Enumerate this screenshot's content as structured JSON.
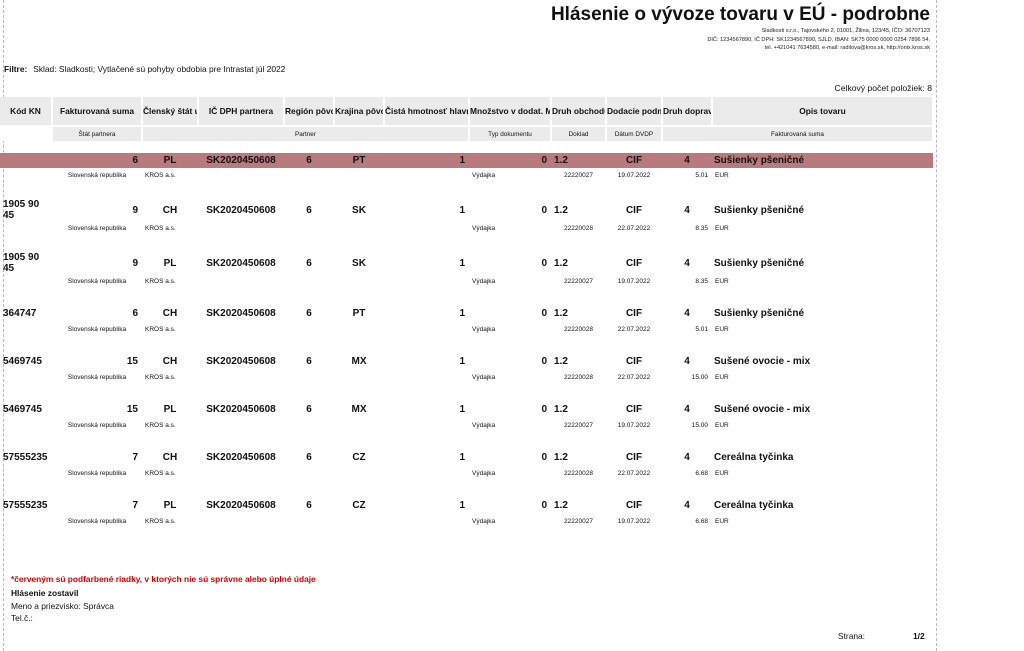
{
  "report": {
    "title": "Hlásenie o vývoze tovaru v EÚ - podrobne",
    "company_lines": [
      "Sladkosti s.r.o., Tajovského 2, 01001, Žilina, 123/45, IČO: 36707123",
      "DIČ: 1234567890, IČ DPH: SK1234567890, SJLD, IBAN: SK75 0000 0000 0254 7896 54,",
      "tel. +421041 7634580, e-mail: radilova@kros.sk, http://onix.kros.sk"
    ],
    "filter_label": "Filtre:",
    "filter_text": "Sklad: Sladkosti; Vytlačené sú pohyby obdobia pre Intrastat júl 2022",
    "total_label": "Celkový počet položiek: 8"
  },
  "headers": {
    "kod_kn": "Kód KN",
    "fakturovana_suma": "Fakturovaná suma",
    "clensky_stat": "Členský štát určenia",
    "ic_dph": "IČ DPH partnera",
    "region": "Región pôvodu",
    "krajina": "Krajina pôvodu",
    "hmotnost": "Čistá hmotnosť hlavnej MJ (kg)",
    "mnozstvo": "Množstvo v dodat. MJ",
    "druh_obchodu": "Druh obchodu",
    "dodacie": "Dodacie podmienky",
    "druh_dopravy": "Druh dopravy",
    "opis": "Opis tovaru"
  },
  "subheaders": {
    "stat_partnera": "Štát partnera",
    "partner": "Partner",
    "typ_dokumentu": "Typ dokumentu",
    "doklad": "Doklad",
    "datum": "Dátum DVDP",
    "fakturovana_suma": "Fakturovaná suma"
  },
  "rows": [
    {
      "kod": "",
      "suma": "6",
      "stat": "PL",
      "icdph": "SK2020450608",
      "region": "6",
      "krajina": "PT",
      "hmot": "1",
      "mnoz": "0",
      "obchod": "1.2",
      "dodacie": "CIF",
      "doprava": "4",
      "opis": "Sušienky pšeničné",
      "error": true,
      "sub": {
        "stat_partnera": "Slovenská republika",
        "partner": "KROS a.s.",
        "typ": "Výdajka",
        "doklad": "22220027",
        "datum": "19.07.2022",
        "suma": "5.01",
        "mena": "EUR"
      }
    },
    {
      "kod": "1905 90 45",
      "suma": "9",
      "stat": "CH",
      "icdph": "SK2020450608",
      "region": "6",
      "krajina": "SK",
      "hmot": "1",
      "mnoz": "0",
      "obchod": "1.2",
      "dodacie": "CIF",
      "doprava": "4",
      "opis": "Sušienky pšeničné",
      "error": false,
      "sub": {
        "stat_partnera": "Slovenská republika",
        "partner": "KROS a.s.",
        "typ": "Výdajka",
        "doklad": "22220028",
        "datum": "22.07.2022",
        "suma": "8.35",
        "mena": "EUR"
      }
    },
    {
      "kod": "1905 90 45",
      "suma": "9",
      "stat": "PL",
      "icdph": "SK2020450608",
      "region": "6",
      "krajina": "SK",
      "hmot": "1",
      "mnoz": "0",
      "obchod": "1.2",
      "dodacie": "CIF",
      "doprava": "4",
      "opis": "Sušienky pšeničné",
      "error": false,
      "sub": {
        "stat_partnera": "Slovenská republika",
        "partner": "KROS a.s.",
        "typ": "Výdajka",
        "doklad": "22220027",
        "datum": "19.07.2022",
        "suma": "8.35",
        "mena": "EUR"
      }
    },
    {
      "kod": "364747",
      "suma": "6",
      "stat": "CH",
      "icdph": "SK2020450608",
      "region": "6",
      "krajina": "PT",
      "hmot": "1",
      "mnoz": "0",
      "obchod": "1.2",
      "dodacie": "CIF",
      "doprava": "4",
      "opis": "Sušienky pšeničné",
      "error": false,
      "sub": {
        "stat_partnera": "Slovenská republika",
        "partner": "KROS a.s.",
        "typ": "Výdajka",
        "doklad": "22220028",
        "datum": "22.07.2022",
        "suma": "5.01",
        "mena": "EUR"
      }
    },
    {
      "kod": "5469745",
      "suma": "15",
      "stat": "CH",
      "icdph": "SK2020450608",
      "region": "6",
      "krajina": "MX",
      "hmot": "1",
      "mnoz": "0",
      "obchod": "1.2",
      "dodacie": "CIF",
      "doprava": "4",
      "opis": "Sušené ovocie - mix",
      "error": false,
      "sub": {
        "stat_partnera": "Slovenská republika",
        "partner": "KROS a.s.",
        "typ": "Výdajka",
        "doklad": "22220028",
        "datum": "22.07.2022",
        "suma": "15.00",
        "mena": "EUR"
      }
    },
    {
      "kod": "5469745",
      "suma": "15",
      "stat": "PL",
      "icdph": "SK2020450608",
      "region": "6",
      "krajina": "MX",
      "hmot": "1",
      "mnoz": "0",
      "obchod": "1.2",
      "dodacie": "CIF",
      "doprava": "4",
      "opis": "Sušené ovocie - mix",
      "error": false,
      "sub": {
        "stat_partnera": "Slovenská republika",
        "partner": "KROS a.s.",
        "typ": "Výdajka",
        "doklad": "22220027",
        "datum": "19.07.2022",
        "suma": "15.00",
        "mena": "EUR"
      }
    },
    {
      "kod": "57555235",
      "suma": "7",
      "stat": "CH",
      "icdph": "SK2020450608",
      "region": "6",
      "krajina": "CZ",
      "hmot": "1",
      "mnoz": "0",
      "obchod": "1.2",
      "dodacie": "CIF",
      "doprava": "4",
      "opis": "Cereálna tyčinka",
      "error": false,
      "sub": {
        "stat_partnera": "Slovenská republika",
        "partner": "KROS a.s.",
        "typ": "Výdajka",
        "doklad": "22220028",
        "datum": "22.07.2022",
        "suma": "6.68",
        "mena": "EUR"
      }
    },
    {
      "kod": "57555235",
      "suma": "7",
      "stat": "PL",
      "icdph": "SK2020450608",
      "region": "6",
      "krajina": "CZ",
      "hmot": "1",
      "mnoz": "0",
      "obchod": "1.2",
      "dodacie": "CIF",
      "doprava": "4",
      "opis": "Cereálna tyčinka",
      "error": false,
      "sub": {
        "stat_partnera": "Slovenská republika",
        "partner": "KROS a.s.",
        "typ": "Výdajka",
        "doklad": "22220027",
        "datum": "19.07.2022",
        "suma": "6.68",
        "mena": "EUR"
      }
    }
  ],
  "footer": {
    "note": "*červeným sú podfarbené riadky, v ktorých nie sú správne alebo úplné údaje",
    "compiled": "Hlásenie zostavil",
    "name": "Meno a priezvisko: Správca",
    "tel": "Tel.č.:",
    "page_label": "Strana:",
    "page_value": "1/2"
  },
  "colors": {
    "error_row": "#b97a7e",
    "note_text": "#d40000",
    "header_bg": "#ebebeb"
  }
}
